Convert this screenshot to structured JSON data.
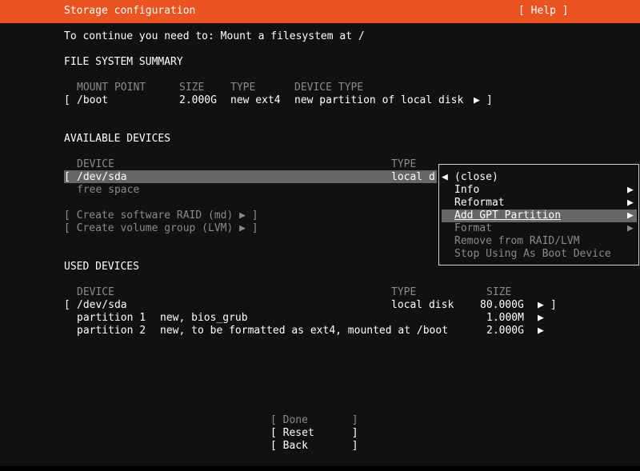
{
  "header": {
    "title": "Storage configuration",
    "help": "[ Help ]"
  },
  "instruction": "To continue you need to: Mount a filesystem at /",
  "fs_summary": {
    "heading": "FILE SYSTEM SUMMARY",
    "columns": [
      "MOUNT POINT",
      "SIZE",
      "TYPE",
      "DEVICE TYPE"
    ],
    "rows": [
      {
        "open": "[",
        "mount": "/boot",
        "size": "2.000G",
        "type": "new ext4",
        "device_type": "new partition of local disk",
        "arrow": "▶",
        "close": "]"
      }
    ]
  },
  "available": {
    "heading": "AVAILABLE DEVICES",
    "col_device": "DEVICE",
    "col_type": "TYPE",
    "selected_row": {
      "open": "[",
      "device": "/dev/sda",
      "type": "local d"
    },
    "free_space": "free space",
    "actions": [
      "[ Create software RAID (md) ▶ ]",
      "[ Create volume group (LVM) ▶ ]"
    ]
  },
  "menu": {
    "close_arrow": "◀",
    "items": [
      {
        "label": "(close)",
        "arrow": "",
        "enabled": true
      },
      {
        "label": "Info",
        "arrow": "▶",
        "enabled": true
      },
      {
        "label": "Reformat",
        "arrow": "▶",
        "enabled": true
      },
      {
        "label": "Add GPT Partition",
        "arrow": "▶",
        "enabled": true,
        "highlighted": true
      },
      {
        "label": "Format",
        "arrow": "▶",
        "enabled": false
      },
      {
        "label": "Remove from RAID/LVM",
        "arrow": "",
        "enabled": false
      },
      {
        "label": "Stop Using As Boot Device",
        "arrow": "",
        "enabled": false
      }
    ]
  },
  "used": {
    "heading": "USED DEVICES",
    "columns": [
      "DEVICE",
      "TYPE",
      "SIZE"
    ],
    "disk": {
      "open": "[",
      "device": "/dev/sda",
      "type": "local disk",
      "size": "80.000G",
      "arrow": "▶",
      "close": "]"
    },
    "partitions": [
      {
        "name": "partition 1",
        "desc": "new, bios_grub",
        "size": "1.000M",
        "arrow": "▶"
      },
      {
        "name": "partition 2",
        "desc": "new, to be formatted as ext4, mounted at /boot",
        "size": "2.000G",
        "arrow": "▶"
      }
    ]
  },
  "buttons": {
    "done": "[ Done       ]",
    "reset": "[ Reset      ]",
    "back": "[ Back       ]"
  },
  "colors": {
    "header_bg": "#e95420",
    "selection_bg": "#666666",
    "dim_text": "#8a8a8a"
  }
}
